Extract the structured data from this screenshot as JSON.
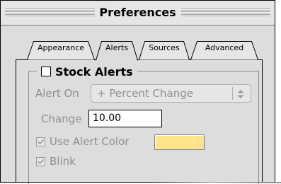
{
  "window": {
    "title": "Preferences"
  },
  "tabs": [
    {
      "label": "Appearance",
      "selected": false
    },
    {
      "label": "Alerts",
      "selected": true
    },
    {
      "label": "Sources",
      "selected": false
    },
    {
      "label": "Advanced",
      "selected": false
    }
  ],
  "stock_alerts": {
    "label": "Stock Alerts",
    "checked": false
  },
  "alert_on": {
    "label": "Alert On",
    "value": "+ Percent Change",
    "enabled": false
  },
  "change": {
    "label": "Change",
    "value": "10.00"
  },
  "use_alert_color": {
    "label": "Use Alert Color",
    "checked": true,
    "enabled": false,
    "color": "#fde48b"
  },
  "blink": {
    "label": "Blink",
    "checked": true,
    "enabled": false
  },
  "colors": {
    "window_bg": "#dddddd",
    "disabled_text": "#8f8f8f"
  }
}
